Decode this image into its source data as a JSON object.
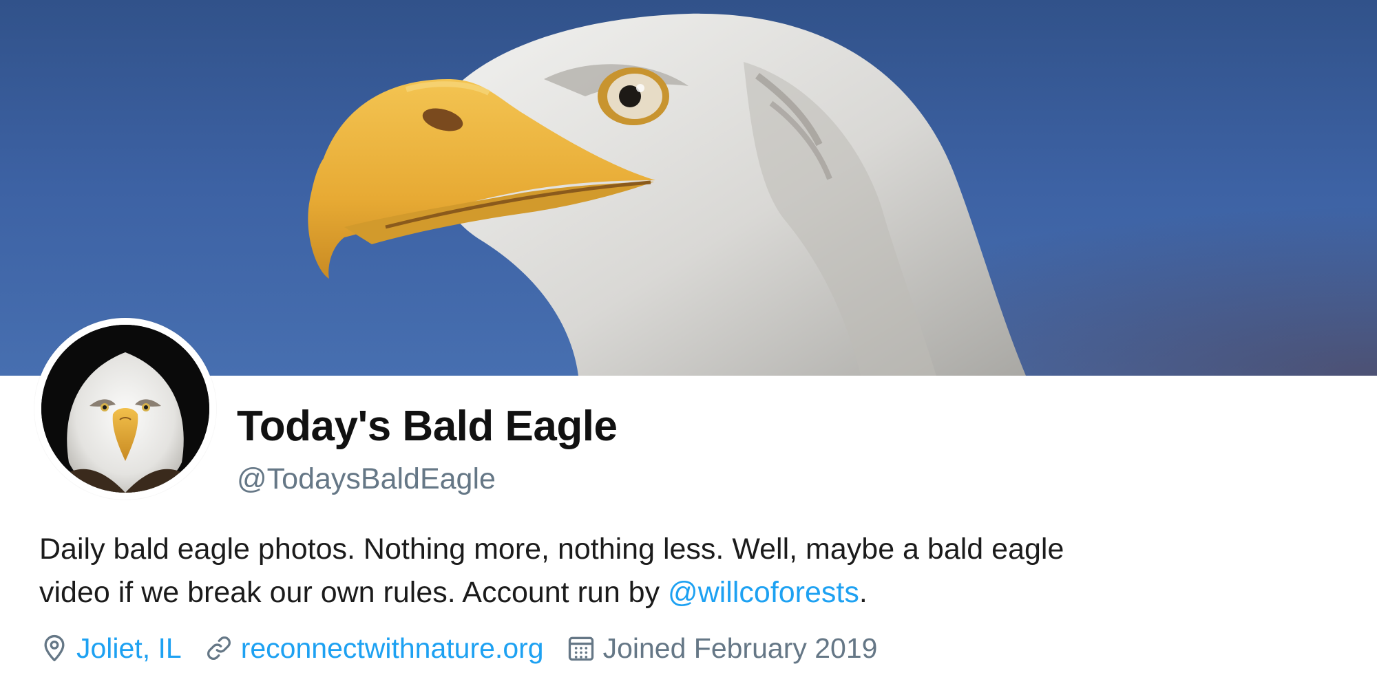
{
  "profile": {
    "display_name": "Today's Bald Eagle",
    "handle": "@TodaysBaldEagle",
    "bio": {
      "line1": "Daily bald eagle photos. Nothing more, nothing less. Well, maybe a bald eagle",
      "line2_prefix": "video if we break our own rules. Account run by ",
      "mention": "@willcoforests",
      "line2_suffix": "."
    },
    "location": "Joliet, IL",
    "website": "reconnectwithnature.org",
    "joined": "Joined February 2019"
  },
  "icons": {
    "location": "location-pin-icon",
    "website": "link-icon",
    "joined": "calendar-icon"
  },
  "colors": {
    "link": "#1da1f2",
    "secondary_text": "#657786",
    "banner_sky": "#4a73b5",
    "beak": "#e9b53a"
  }
}
